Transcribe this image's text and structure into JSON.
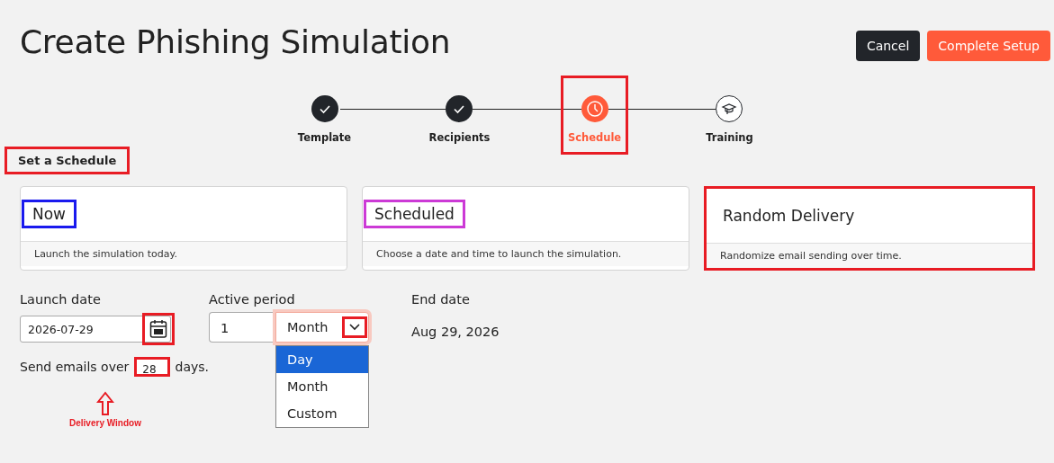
{
  "title": "Create Phishing Simulation",
  "buttons": [
    {
      "label": "Cancel",
      "kind": "secondary"
    },
    {
      "label": "Complete Setup",
      "kind": "primary"
    }
  ],
  "steps": [
    {
      "label": "Template",
      "kind": "done"
    },
    {
      "label": "Recipients",
      "kind": "done"
    },
    {
      "label": "Schedule",
      "kind": "current",
      "color": "#e81c24"
    },
    {
      "label": "Training",
      "kind": "upcoming"
    }
  ],
  "section_title": {
    "text": "Set a Schedule",
    "color": "#e81c24"
  },
  "options": [
    {
      "title": "Now",
      "description": "Launch the simulation today.",
      "color": "#1a1aee",
      "kind": "title"
    },
    {
      "title": "Scheduled",
      "description": "Choose a date and time to launch the simulation.",
      "color": "#cc3ad6",
      "kind": "title"
    },
    {
      "title": "Random Delivery",
      "description": "Randomize email sending over time.",
      "color": "#e81c24",
      "kind": "card"
    }
  ],
  "launch_date": {
    "label": "Launch date",
    "value": "2026-07-29"
  },
  "active_period": {
    "label": "Active period",
    "value": "1",
    "unit": "Month",
    "options": [
      {
        "label": "Day",
        "selected": true
      },
      {
        "label": "Month",
        "selected": false
      },
      {
        "label": "Custom",
        "selected": false
      }
    ]
  },
  "end_date": {
    "label": "End date",
    "value": "Aug 29, 2026"
  },
  "send_over": {
    "prefix": "Send emails over",
    "value": "28",
    "suffix": "days."
  },
  "callout": {
    "text": "Delivery Window",
    "color": "#e81c24"
  }
}
